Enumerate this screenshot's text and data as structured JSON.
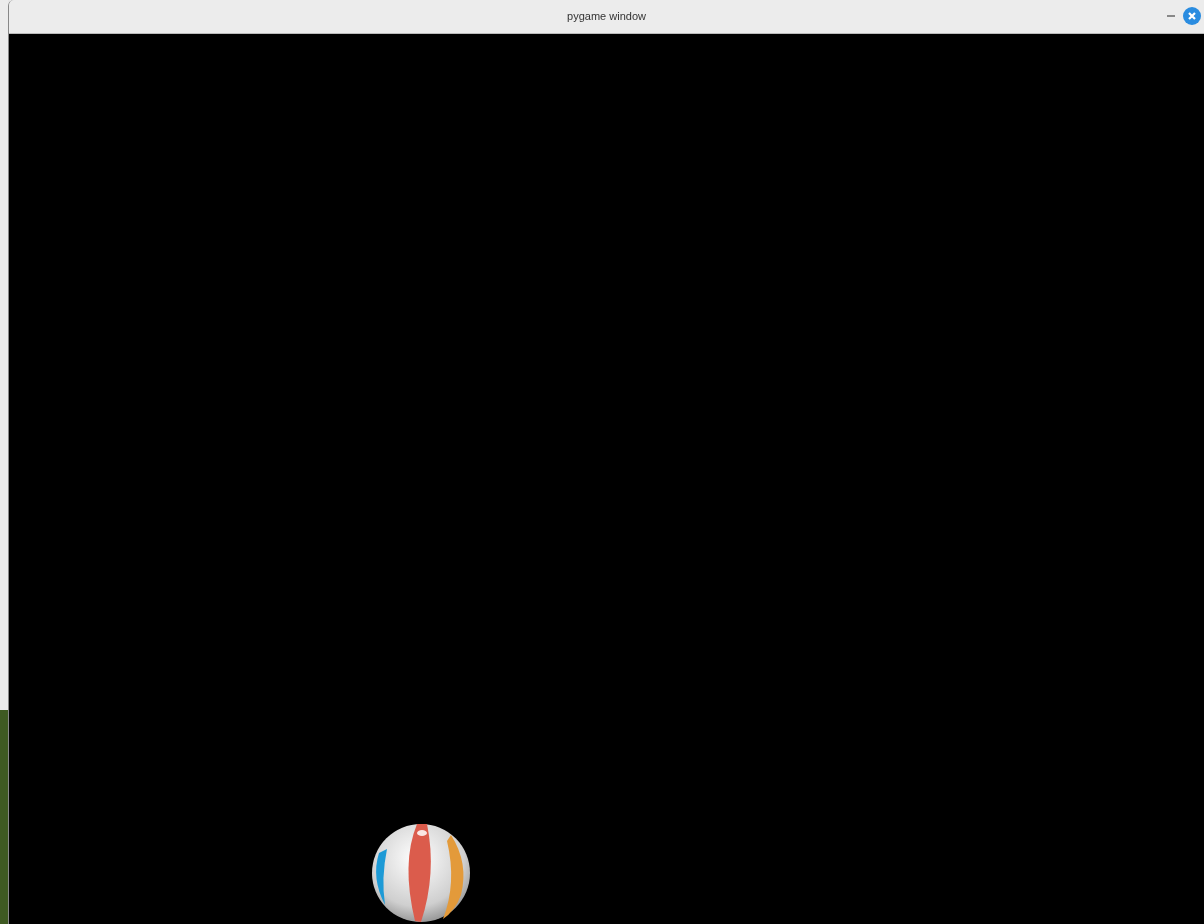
{
  "window": {
    "title": "pygame window"
  }
}
